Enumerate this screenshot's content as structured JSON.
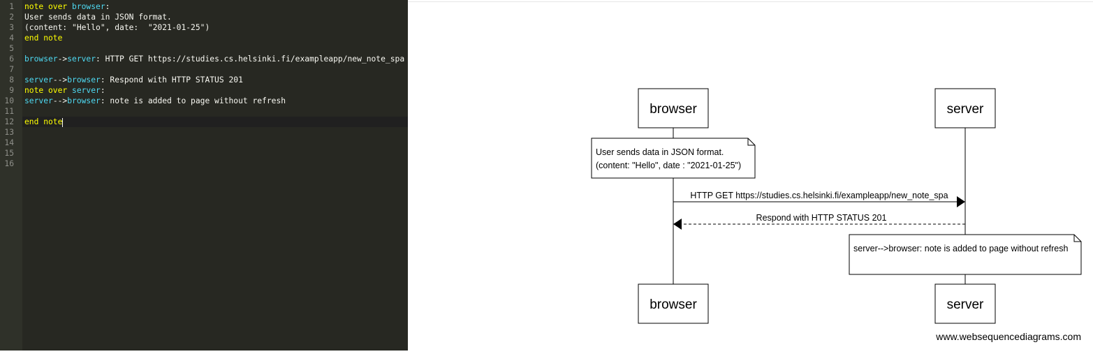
{
  "editor": {
    "lines": [
      {
        "no": "1",
        "tokens": [
          {
            "t": "note over ",
            "c": "kw"
          },
          {
            "t": "browser",
            "c": "part"
          },
          {
            "t": ":",
            "c": "plain"
          }
        ]
      },
      {
        "no": "2",
        "tokens": [
          {
            "t": "User sends data in JSON format.",
            "c": "plain"
          }
        ]
      },
      {
        "no": "3",
        "tokens": [
          {
            "t": "(content: \"Hello\", date:  \"2021-01-25\")",
            "c": "plain"
          }
        ]
      },
      {
        "no": "4",
        "tokens": [
          {
            "t": "end note",
            "c": "kw"
          }
        ]
      },
      {
        "no": "5",
        "tokens": []
      },
      {
        "no": "6",
        "tokens": [
          {
            "t": "browser",
            "c": "part"
          },
          {
            "t": "->",
            "c": "plain"
          },
          {
            "t": "server",
            "c": "part"
          },
          {
            "t": ": HTTP GET https://studies.cs.helsinki.fi/exampleapp/new_note_spa",
            "c": "plain"
          }
        ]
      },
      {
        "no": "7",
        "tokens": []
      },
      {
        "no": "8",
        "tokens": [
          {
            "t": "server",
            "c": "part"
          },
          {
            "t": "-->",
            "c": "plain"
          },
          {
            "t": "browser",
            "c": "part"
          },
          {
            "t": ": Respond with HTTP STATUS 201",
            "c": "plain"
          }
        ]
      },
      {
        "no": "9",
        "tokens": [
          {
            "t": "note over ",
            "c": "kw"
          },
          {
            "t": "server",
            "c": "part"
          },
          {
            "t": ":",
            "c": "plain"
          }
        ]
      },
      {
        "no": "10",
        "tokens": [
          {
            "t": "server",
            "c": "part"
          },
          {
            "t": "-->",
            "c": "plain"
          },
          {
            "t": "browser",
            "c": "part"
          },
          {
            "t": ": note is added to page without refresh",
            "c": "plain"
          }
        ]
      },
      {
        "no": "11",
        "tokens": []
      },
      {
        "no": "12",
        "tokens": [
          {
            "t": "end note",
            "c": "kw"
          }
        ],
        "active": true
      },
      {
        "no": "13",
        "tokens": []
      },
      {
        "no": "14",
        "tokens": []
      },
      {
        "no": "15",
        "tokens": []
      },
      {
        "no": "16",
        "tokens": []
      }
    ],
    "colors": {
      "keyword": "#ffff00",
      "participant": "#4ed9f2",
      "text": "#f8f8f2",
      "background": "#272822"
    }
  },
  "diagram": {
    "participant_browser": "browser",
    "participant_server": "server",
    "note1_line1": "User sends data in JSON format.",
    "note1_line2": "(content: \"Hello\", date :  \"2021-01-25\")",
    "message_get": "HTTP GET https://studies.cs.helsinki.fi/exampleapp/new_note_spa",
    "message_response": "Respond with HTTP STATUS 201",
    "note2_text": "server-->browser: note is added to page without refresh",
    "watermark": "www.websequencediagrams.com"
  }
}
